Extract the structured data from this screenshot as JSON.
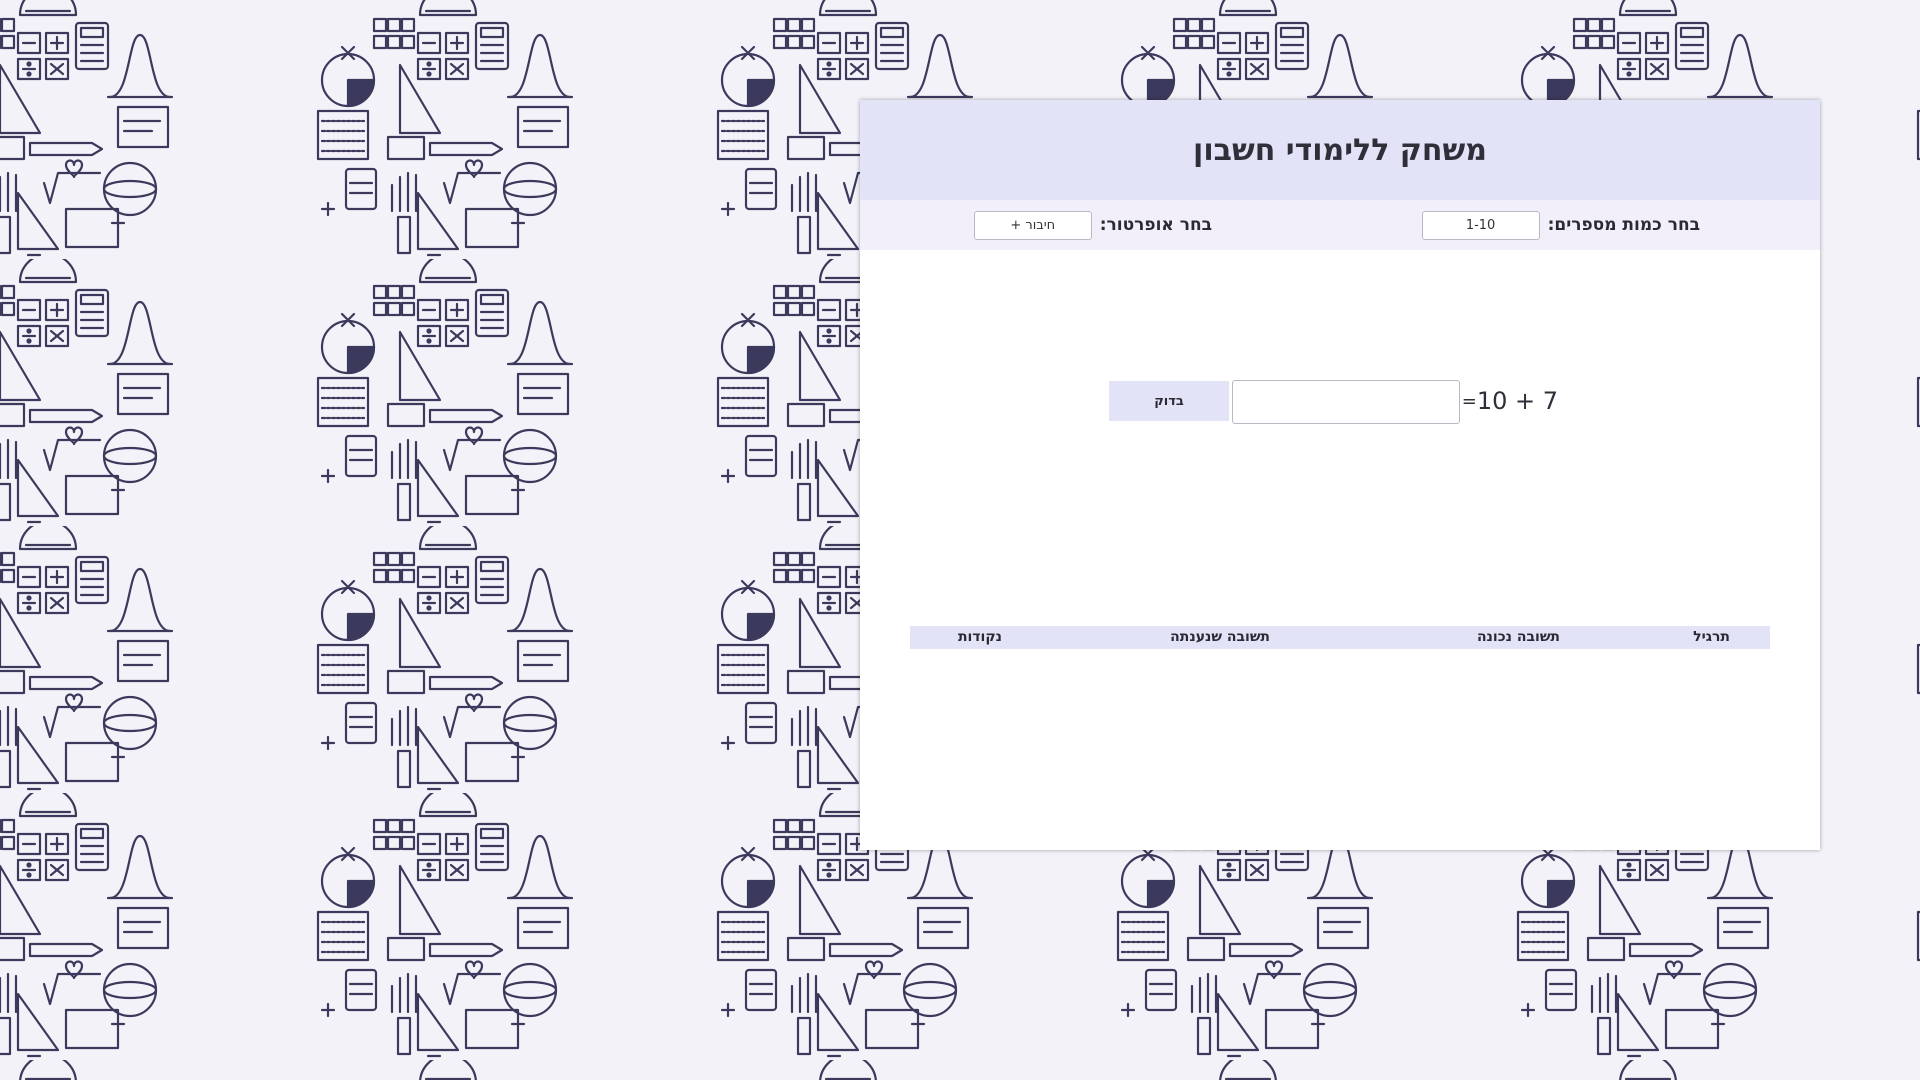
{
  "header": {
    "title": "משחק ללימודי חשבון"
  },
  "options": {
    "range_label": "בחר כמות מספרים:",
    "range_value": "1-10",
    "operator_label": "בחר אופרטור:",
    "operator_value": "חיבור +"
  },
  "exercise": {
    "question": "10 + 7",
    "equals": "=",
    "answer_value": "",
    "check_label": "בדוק"
  },
  "results": {
    "columns": [
      "תרגיל",
      "תשובה נכונה",
      "תשובה שנענתה",
      "נקודות"
    ]
  },
  "colors": {
    "background": "#f4f2f9",
    "header": "#e3e3f7",
    "options_bar": "#f2eefa",
    "doodle": "#3c3a5c"
  },
  "icons": [
    "calculator-icon",
    "protractor-icon",
    "ruler-icon",
    "bell-curve-icon",
    "sphere-icon",
    "plus-icon",
    "minus-icon",
    "times-icon",
    "divide-icon"
  ]
}
